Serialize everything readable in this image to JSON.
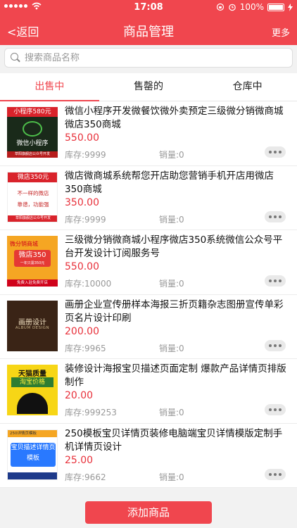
{
  "status": {
    "time": "17:08",
    "battery": "100%",
    "signal_icon": "signal-icon",
    "wifi_icon": "wifi-icon"
  },
  "nav": {
    "back_label": "<返回",
    "title": "商品管理",
    "more_label": "更多"
  },
  "search": {
    "placeholder": "搜索商品名称",
    "value": ""
  },
  "tabs": [
    {
      "label": "出售中",
      "active": true
    },
    {
      "label": "售罄的",
      "active": false
    },
    {
      "label": "仓库中",
      "active": false
    }
  ],
  "products": [
    {
      "title": "微信小程序开发微餐饮微外卖预定三级微分销微商城微店350商城",
      "price": "550.00",
      "stock": "库存:9999",
      "sales": "销量:0",
      "thumb": {
        "band": "小程序580元",
        "main": "微信小程序",
        "foot": "草阳旗舰店公众号开发"
      }
    },
    {
      "title": "微店微商城系统帮您开店助您营销手机开店用微店350商城",
      "price": "350.00",
      "stock": "库存:9999",
      "sales": "销量:0",
      "thumb": {
        "band": "微店350元",
        "l1": "不一样的微店",
        "l2": "靠谱，功能强",
        "foot": "草阳旗舰店公众号开发"
      }
    },
    {
      "title": "三级微分销微商城小程序微店350系统微信公众号平台开发设计订阅服务号",
      "price": "550.00",
      "stock": "库存:10000",
      "sales": "销量:0",
      "thumb": {
        "l1": "微分销商城",
        "main": "微店350",
        "sub": "一年只需350元",
        "foot": "免费入驻免费开店"
      }
    },
    {
      "title": "画册企业宣传册样本海报三折页籍杂志图册宣传单彩页名片设计印刷",
      "price": "200.00",
      "stock": "库存:9965",
      "sales": "销量:0",
      "thumb": {
        "l1": "画册设计",
        "l2": "ALBUM DESIGN"
      }
    },
    {
      "title": "装修设计海报宝贝描述页面定制 爆款产品详情页排版制作",
      "price": "20.00",
      "stock": "库存:999253",
      "sales": "销量:0",
      "thumb": {
        "l1": "天猫质量",
        "l2": "淘宝价格"
      }
    },
    {
      "title": "250模板宝贝详情页装修电脑端宝贝详情模版定制手机详情页设计",
      "price": "25.00",
      "stock": "库存:9662",
      "sales": "销量:0",
      "thumb": {
        "band": "250详情页模板",
        "main": "宝贝描述详情页模板"
      }
    }
  ],
  "bottom": {
    "add_label": "添加商品"
  },
  "colors": {
    "brand": "#f0464e",
    "price": "#e8303a"
  }
}
